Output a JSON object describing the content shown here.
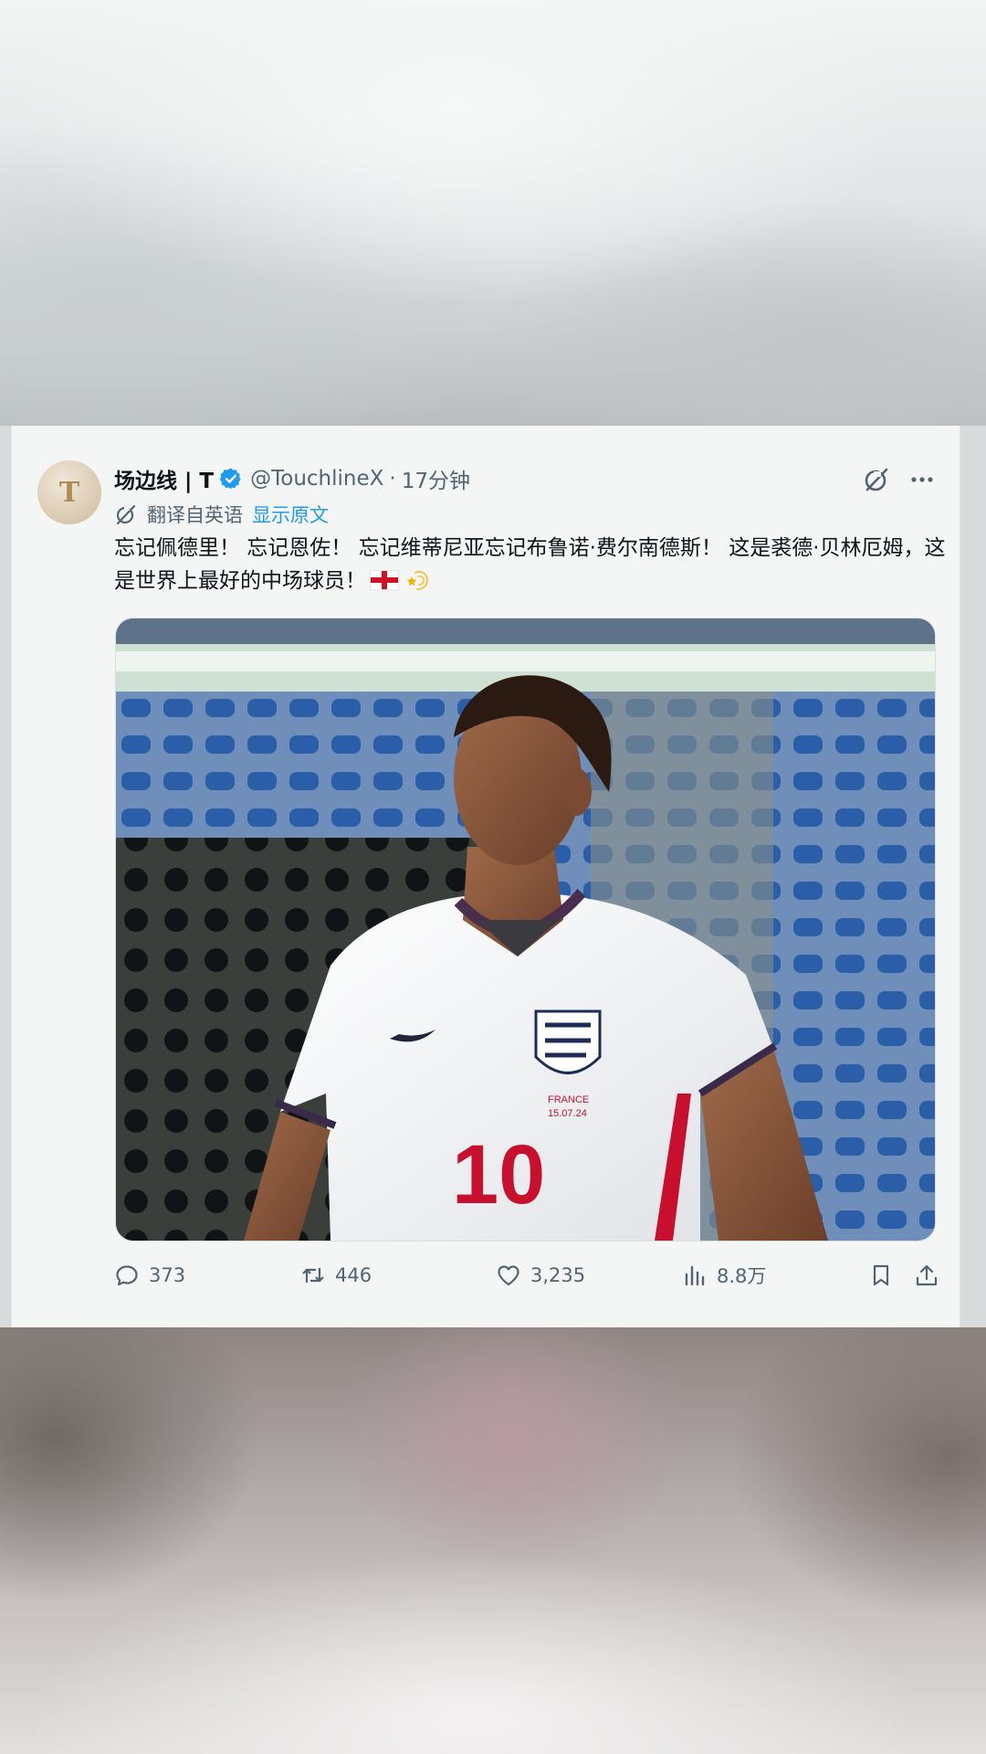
{
  "tweet": {
    "avatar_letter": "T",
    "author_name": "场边线 | T",
    "handle": "@TouchlineX",
    "separator": "·",
    "time": "17分钟",
    "translated_from": "翻译自英语",
    "show_original": "显示原文",
    "text": "忘记佩德里！ 忘记恩佐！ 忘记维蒂尼亚忘记布鲁诺·费尔南德斯！ 这是裘德·贝林厄姆，这是世界上最好的中场球员！",
    "emoji_icons": [
      "england-flag-icon",
      "dizzy-star-icon"
    ]
  },
  "media": {
    "description_icon": "photo",
    "jersey_number": "10",
    "jersey_text_line1": "FRANCE",
    "jersey_text_line2": "15.07.24"
  },
  "actions": {
    "replies": "373",
    "retweets": "446",
    "likes": "3,235",
    "views": "8.8万"
  },
  "colors": {
    "accent": "#1d9bf0",
    "secondary_text": "#536471",
    "primary_text": "#0f1419",
    "card_bg": "#f4f6f6"
  }
}
